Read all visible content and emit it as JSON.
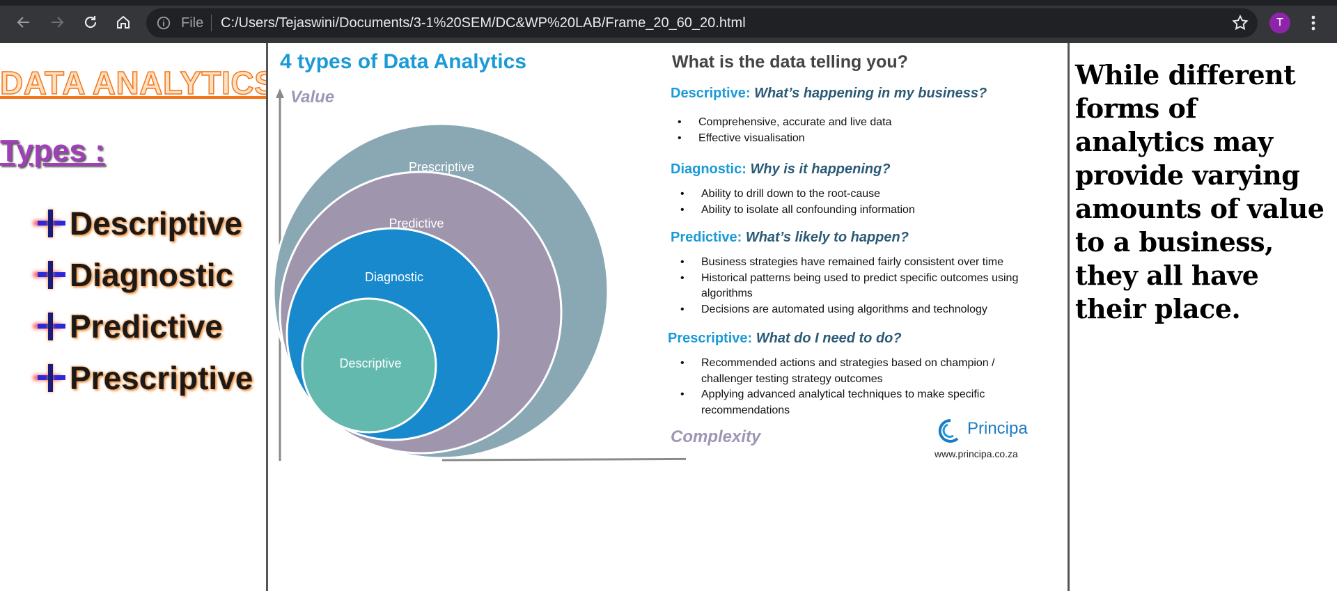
{
  "browser": {
    "file_label": "File",
    "url": "C:/Users/Tejaswini/Documents/3-1%20SEM/DC&WP%20LAB/Frame_20_60_20.html",
    "profile_initial": "T",
    "profile_color": "#8e24aa"
  },
  "left_frame": {
    "title": "DATA ANALYTICS",
    "types_label": "Types :",
    "items": [
      "Descriptive",
      "Diagnostic",
      "Predictive",
      "Prescriptive"
    ]
  },
  "middle_frame": {
    "title": "4 types of Data Analytics",
    "axis_value_label": "Value",
    "axis_complexity_label": "Complexity",
    "circles": [
      "Prescriptive",
      "Predictive",
      "Diagnostic",
      "Descriptive"
    ],
    "circle_colors": [
      "#8aa8b4",
      "#9f95ad",
      "#1789cc",
      "#63b9ae"
    ],
    "question_title": "What is the data telling you?",
    "sections": [
      {
        "label": "Descriptive:",
        "question": "What’s happening in my business?",
        "bullets": [
          "Comprehensive, accurate and live data",
          "Effective visualisation"
        ]
      },
      {
        "label": "Diagnostic:",
        "question": "Why is it happening?",
        "bullets": [
          "Ability to drill down to the root-cause",
          "Ability to isolate all confounding information"
        ]
      },
      {
        "label": "Predictive:",
        "question": "What’s likely to happen?",
        "bullets": [
          "Business strategies have remained fairly consistent over time",
          "Historical patterns being used to predict specific outcomes using algorithms",
          "Decisions are automated using algorithms and technology"
        ]
      },
      {
        "label": "Prescriptive:",
        "question": "What do I need to do?",
        "bullets": [
          "Recommended actions and strategies based on champion / challenger testing strategy outcomes",
          "Applying advanced analytical techniques to make specific recommendations"
        ]
      }
    ],
    "logo_name": "Principa",
    "logo_url": "www.principa.co.za"
  },
  "right_frame": {
    "text": "While different forms of analytics may provide varying amounts of value to a business, they all have their place."
  }
}
